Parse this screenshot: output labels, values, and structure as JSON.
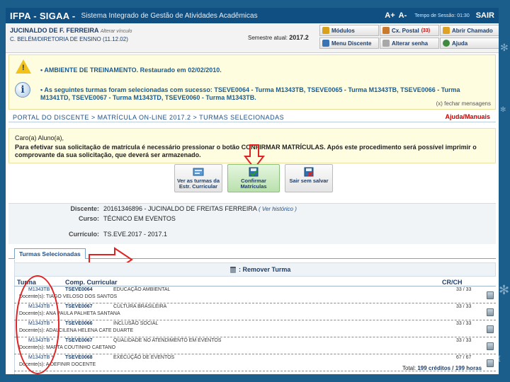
{
  "header": {
    "brand": "IFPA - SIGAA -",
    "system_name": "Sistema Integrado de Gestão de Atividades Acadêmicas",
    "font_increase": "A+",
    "font_decrease": "A-",
    "session": "Tempo de Sessão: 01:30",
    "logout": "SAIR"
  },
  "user": {
    "name": "JUCINALDO DE F. FERREIRA",
    "change_link": "Alterar vínculo",
    "department": "C. BELÉM/DIRETORIA DE ENSINO (11.12.02)",
    "semester_label": "Semestre atual:",
    "semester_value": "2017.2"
  },
  "quick_links": [
    {
      "label": "Módulos",
      "badge": "",
      "icon": "modules-icon",
      "color": "#d9a11a"
    },
    {
      "label": "Cx. Postal",
      "badge": "(33)",
      "icon": "mailbox-icon",
      "color": "#c97a2a"
    },
    {
      "label": "Abrir Chamado",
      "badge": "",
      "icon": "ticket-icon",
      "color": "#e0a224"
    },
    {
      "label": "Menu Discente",
      "badge": "",
      "icon": "student-menu-icon",
      "color": "#3b74b4"
    },
    {
      "label": "Alterar senha",
      "badge": "",
      "icon": "key-icon",
      "color": "#a8a8a8"
    },
    {
      "label": "Ajuda",
      "badge": "",
      "icon": "help-icon",
      "color": "#3f8a3f"
    }
  ],
  "messages": {
    "warning": "AMBIENTE DE TREINAMENTO. Restaurado em 02/02/2010.",
    "info": "As seguintes turmas foram selecionadas com sucesso: TSEVE0064 - Turma M1343TB, TSEVE0065 - Turma M1343TB, TSEVE0066 - Turma M1341TD, TSEVE0067 - Turma M1343TD, TSEVE0060 - Turma M1343TB.",
    "close": "(x) fechar mensagens"
  },
  "breadcrumb": "PORTAL DO DISCENTE > MATRÍCULA ON-LINE 2017.2 > TURMAS SELECIONADAS",
  "help_link": "Ajuda/Manuais",
  "instructions": {
    "greeting": "Caro(a) Aluno(a),",
    "text": "Para efetivar sua solicitação de matrícula é necessário pressionar o botão CONFIRMAR MATRÍCULAS. Após este procedimento será possível imprimir o comprovante da sua solicitação, que deverá ser armazenado."
  },
  "actions": {
    "view_curriculum": "Ver as turmas da Estr. Curricular",
    "confirm": "Confirmar Matrículas",
    "exit": "Sair sem salvar"
  },
  "student": {
    "discente_label": "Discente:",
    "discente_value": "20161346896 - JUCINALDO DE FREITAS FERREIRA",
    "history_link": "( Ver histórico )",
    "curso_label": "Curso:",
    "curso_value": "TÉCNICO EM EVENTOS",
    "curriculo_label": "Currículo:",
    "curriculo_value": "TS.EVE.2017 - 2017.1"
  },
  "tab_label": "Turmas Selecionadas",
  "remove_label": ": Remover Turma",
  "table": {
    "headers": {
      "turma": "Turma",
      "comp": "Comp. Curricular",
      "crch": "CR/CH"
    },
    "rows": [
      {
        "turma": "M1343TB *",
        "code": "TSEVE0064",
        "name": "EDUCAÇÃO AMBIENTAL",
        "ch": "33 / 33",
        "docente": "Docente(s): TIAGO VELOSO DOS SANTOS"
      },
      {
        "turma": "M1343TB *",
        "code": "TSEVE0067",
        "name": "CULTURA BRASILEIRA",
        "ch": "33 / 33",
        "docente": "Docente(s): ANA PAULA PALHETA SANTANA"
      },
      {
        "turma": "M1343TB *",
        "code": "TSEVE0066",
        "name": "INCLUSÃO SOCIAL",
        "ch": "33 / 33",
        "docente": "Docente(s): ADALCILENA HELENA CATE DUARTE"
      },
      {
        "turma": "M1343TB *",
        "code": "TSEVE0067",
        "name": "QUALIDADE NO ATENDIMENTO EM EVENTOS",
        "ch": "33 / 33",
        "docente": "Docente(s): MARTA COUTINHO CAETANO"
      },
      {
        "turma": "M1343TB *",
        "code": "TSEVE0068",
        "name": "EXECUÇÃO DE EVENTOS",
        "ch": "67 / 67",
        "docente": "Docente(s): A DEFINIR DOCENTE"
      }
    ]
  },
  "total": {
    "label": "Total:",
    "value": "199 créditos / 199 horas"
  }
}
